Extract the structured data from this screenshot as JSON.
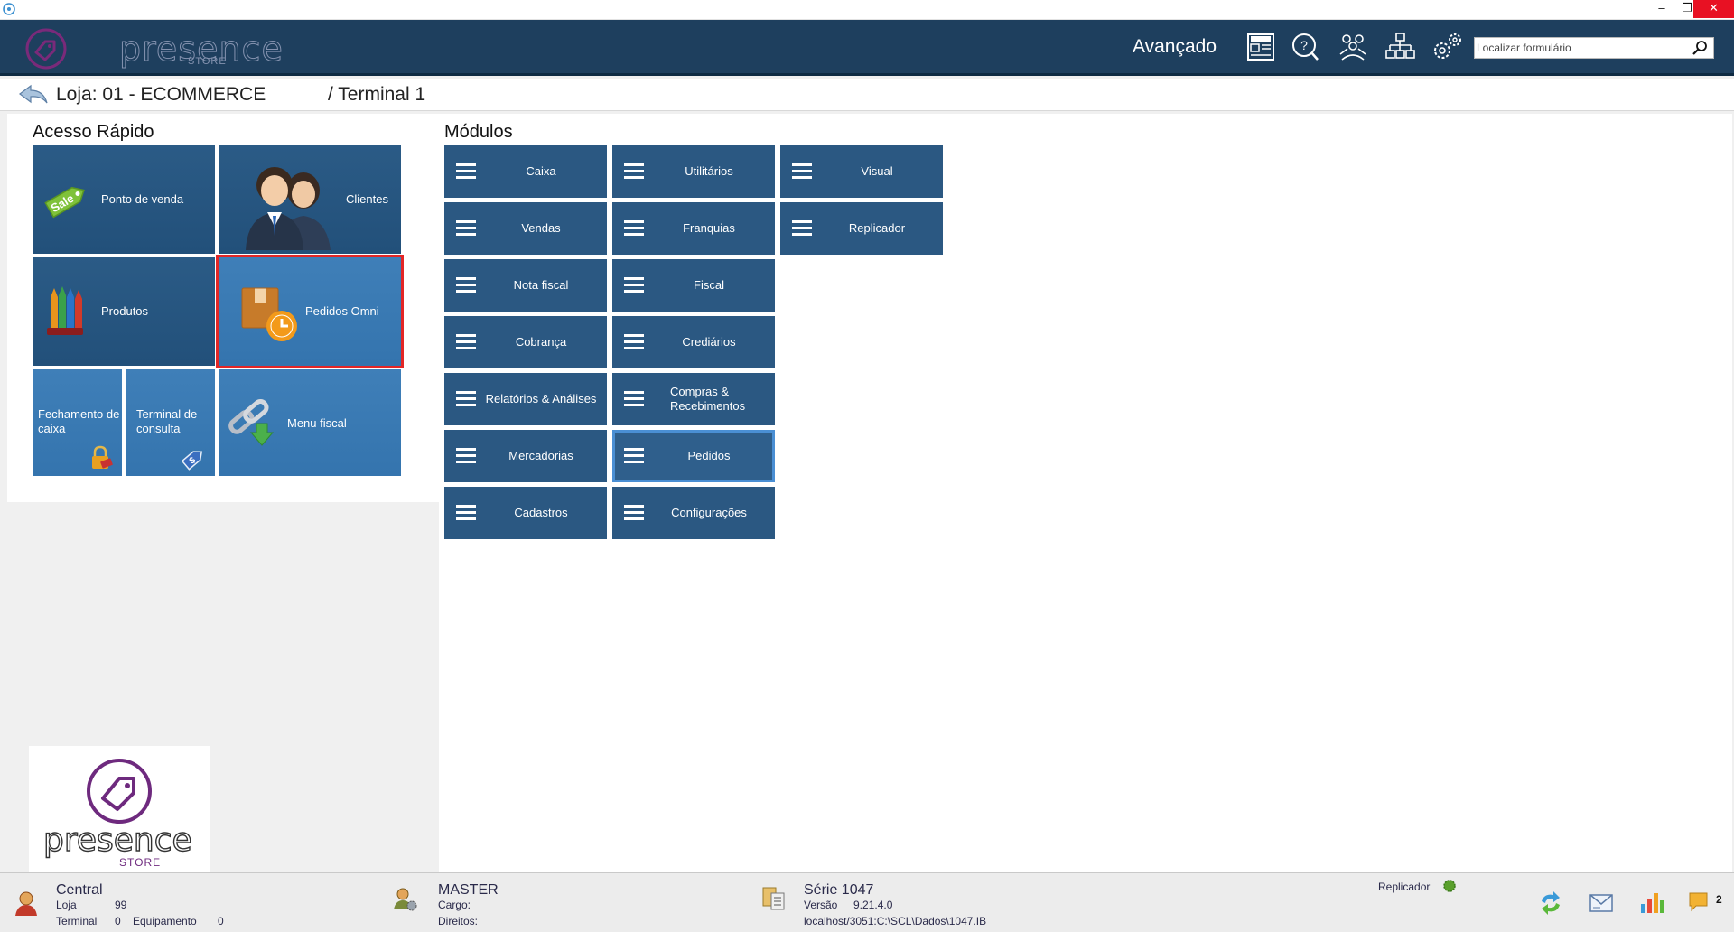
{
  "window": {
    "minimize_glyph": "–",
    "maximize_glyph": "❐",
    "close_glyph": "✕"
  },
  "header": {
    "logo_text": "presence",
    "logo_sub": "STORE",
    "mode_label": "Avançado",
    "icons": [
      "news-icon",
      "help-chat-icon",
      "users-group-icon",
      "network-icon",
      "settings-gears-icon"
    ],
    "search": {
      "placeholder": "Localizar formulário",
      "value": ""
    }
  },
  "breadcrumb": {
    "store": "Loja: 01 - ECOMMERCE",
    "terminal": "/ Terminal 1"
  },
  "quick_access": {
    "title": "Acesso Rápido",
    "tiles": [
      {
        "label": "Ponto de venda",
        "icon": "sale-tag-icon"
      },
      {
        "label": "Clientes",
        "icon": "clients-people-icon"
      },
      {
        "label": "Produtos",
        "icon": "products-crayons-icon"
      },
      {
        "label": "Pedidos Omni",
        "icon": "box-clock-icon",
        "selected": true
      },
      {
        "label": "Fechamento de caixa",
        "icon": "lock-icon"
      },
      {
        "label": "Terminal de consulta",
        "icon": "price-tag-icon"
      },
      {
        "label": "Menu fiscal",
        "icon": "chain-download-icon"
      }
    ]
  },
  "modules": {
    "title": "Módulos",
    "columns": [
      [
        "Caixa",
        "Vendas",
        "Nota fiscal",
        "Cobrança",
        "Relatórios & Análises",
        "Mercadorias",
        "Cadastros"
      ],
      [
        "Utilitários",
        "Franquias",
        "Fiscal",
        "Crediários",
        "Compras & Recebimentos",
        "Pedidos",
        "Configurações"
      ],
      [
        "Visual",
        "Replicador"
      ]
    ],
    "selected": "Pedidos"
  },
  "colors": {
    "header_bg": "#1e3f5e",
    "tile_bg": "#2b5882",
    "tile_light_bg": "#3474ae",
    "selected_red": "#e32626",
    "selected_blue": "#4a8fd4",
    "status_green": "#5aa02c"
  },
  "status": {
    "user_block": {
      "title": "Central",
      "loja_label": "Loja",
      "loja_value": "99",
      "terminal_label": "Terminal",
      "terminal_value": "0",
      "equip_label": "Equipamento",
      "equip_value": "0"
    },
    "master_block": {
      "title": "MASTER",
      "cargo": "Cargo:",
      "direitos": "Direitos:"
    },
    "serie_block": {
      "title": "Série  1047",
      "versao_label": "Versão",
      "versao_value": "9.21.4.0",
      "path": "localhost/3051:C:\\SCL\\Dados\\1047.IB"
    },
    "replicador_label": "Replicador",
    "notifications_count": "2"
  }
}
